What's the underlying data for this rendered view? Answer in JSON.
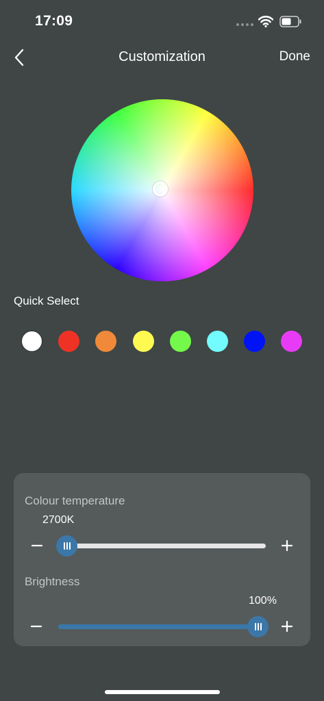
{
  "status_bar": {
    "time": "17:09"
  },
  "nav": {
    "back_icon": "chevron-left-icon",
    "title": "Customization",
    "done_label": "Done"
  },
  "color_wheel": {
    "selected_color": "#ffffff"
  },
  "quick_select": {
    "label": "Quick Select",
    "swatches": [
      {
        "name": "white",
        "color": "#ffffff"
      },
      {
        "name": "red",
        "color": "#ee3326"
      },
      {
        "name": "orange",
        "color": "#f08a3a"
      },
      {
        "name": "yellow",
        "color": "#fffa52"
      },
      {
        "name": "green",
        "color": "#74f94b"
      },
      {
        "name": "cyan",
        "color": "#72fcfd"
      },
      {
        "name": "blue",
        "color": "#0013f5"
      },
      {
        "name": "magenta",
        "color": "#e83bf5"
      }
    ]
  },
  "colour_temperature": {
    "label": "Colour temperature",
    "value_text": "2700K",
    "level": 0.0,
    "track_color": "#e6e6e6"
  },
  "brightness": {
    "label": "Brightness",
    "value_text": "100%",
    "level": 1.0,
    "track_color": "#3b77a8"
  },
  "colors": {
    "background": "#3f4645",
    "panel": "#555a5a",
    "accent": "#3b77a8"
  }
}
